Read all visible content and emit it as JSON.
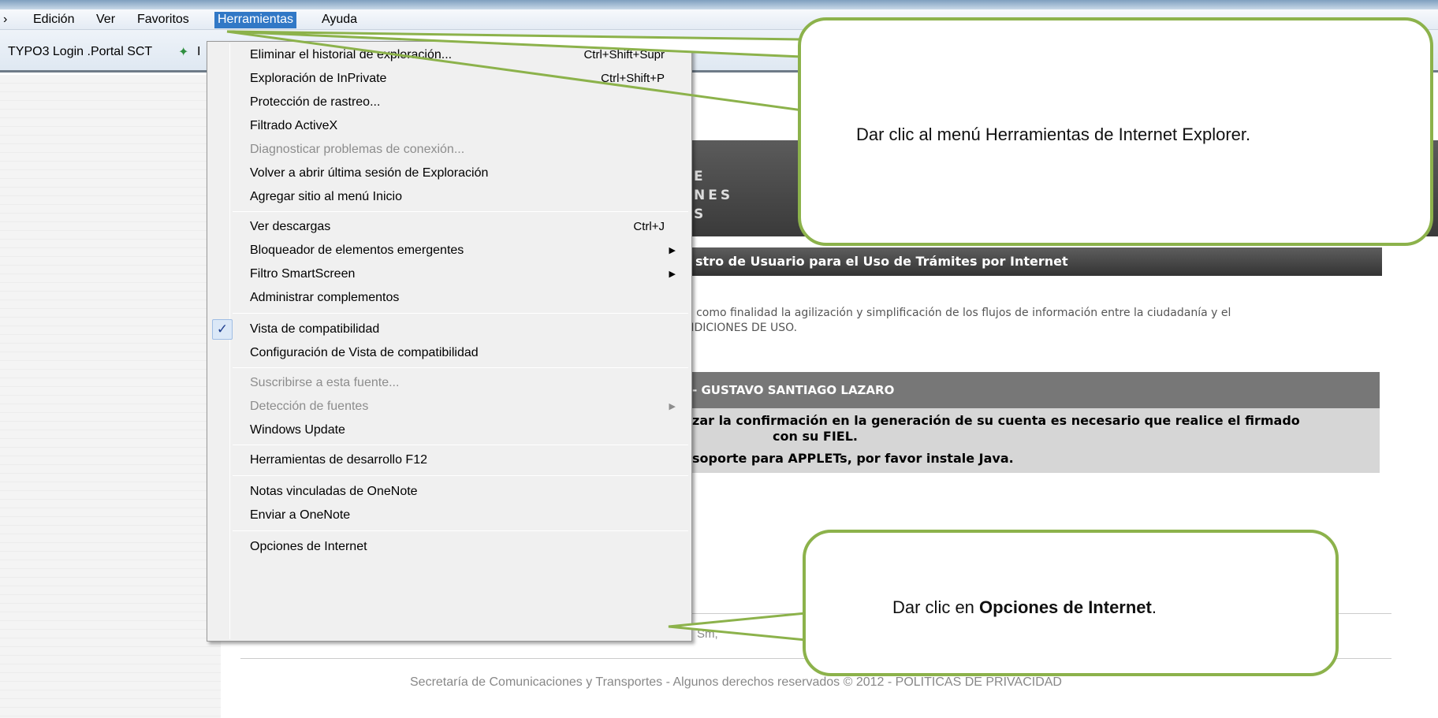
{
  "menubar": {
    "items": [
      "Edición",
      "Ver",
      "Favoritos",
      "Herramientas",
      "Ayuda"
    ],
    "partial_first": "›"
  },
  "favorites": {
    "text": "TYPO3 Login .Portal SCT",
    "trailing": "I"
  },
  "tools_menu": {
    "items": [
      {
        "label": "Eliminar el historial de exploración...",
        "shortcut": "Ctrl+Shift+Supr"
      },
      {
        "label": "Exploración de InPrivate",
        "shortcut": "Ctrl+Shift+P"
      },
      {
        "label": "Protección de rastreo..."
      },
      {
        "label": "Filtrado ActiveX"
      },
      {
        "label": "Diagnosticar problemas de conexión..."
      },
      {
        "label": "Volver a abrir última sesión de Exploración"
      },
      {
        "label": "Agregar sitio al menú Inicio"
      },
      {
        "label": "Ver descargas",
        "shortcut": "Ctrl+J"
      },
      {
        "label": "Bloqueador de elementos emergentes"
      },
      {
        "label": "Filtro SmartScreen"
      },
      {
        "label": "Administrar complementos"
      },
      {
        "label": "Vista de compatibilidad"
      },
      {
        "label": "Configuración de Vista de compatibilidad"
      },
      {
        "label": "Suscribirse a esta fuente..."
      },
      {
        "label": "Detección de fuentes"
      },
      {
        "label": "Windows Update"
      },
      {
        "label": "Herramientas de desarrollo F12"
      },
      {
        "label": "Notas vinculadas de OneNote"
      },
      {
        "label": "Enviar a OneNote"
      },
      {
        "label": "Opciones de Internet"
      }
    ]
  },
  "page": {
    "banner_lines": [
      "E",
      "NES",
      "S"
    ],
    "registration_title": "stro de Usuario para el Uso de Trámites por Internet",
    "description_line1": "e como finalidad la agilización y simplificación de los flujos de información entre la ciudadanía y el",
    "description_line2": "NDICIONES DE USO.",
    "user_bar": "- GUSTAVO SANTIAGO LAZARO",
    "confirm_line1": "zar la confirmación en la generación de su cuenta es necesario que realice el firmado",
    "confirm_line2": "con su FIEL.",
    "confirm_line3": "soporte para APPLETs, por favor instale Java.",
    "under_menu": "Sm,",
    "footer": "Secretaría de Comunicaciones y Transportes - Algunos derechos reservados © 2012 - POLITICAS DE PRIVACIDAD"
  },
  "callouts": {
    "top": "Dar clic al menú Herramientas de Internet Explorer.",
    "bottom_prefix": "Dar clic  en ",
    "bottom_bold": "Opciones de Internet",
    "bottom_suffix": "."
  },
  "colors": {
    "callout_border": "#8cb24b",
    "menu_highlight": "#3178c6"
  }
}
